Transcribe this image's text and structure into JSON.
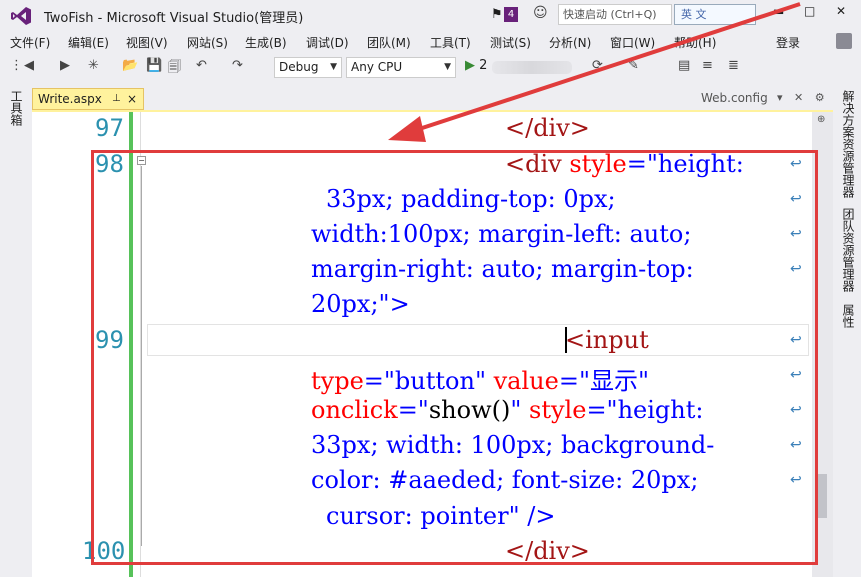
{
  "window": {
    "title": "TwoFish - Microsoft Visual Studio(管理员)",
    "notification_count": "4",
    "quick_launch_placeholder": "快速启动 (Ctrl+Q)",
    "ime_label": "英 文"
  },
  "menu": {
    "items": [
      "文件(F)",
      "编辑(E)",
      "视图(V)",
      "网站(S)",
      "生成(B)",
      "调试(D)",
      "团队(M)",
      "工具(T)",
      "测试(S)",
      "分析(N)",
      "窗口(W)",
      "帮助(H)"
    ],
    "login": "登录"
  },
  "toolbar": {
    "configuration": "Debug",
    "platform": "Any CPU",
    "start_label": "▶",
    "start_prefix": "2"
  },
  "side_panels": {
    "left": "工具箱",
    "right": [
      "解决方案资源管理器",
      "团队资源管理器",
      "属性"
    ]
  },
  "tabs": {
    "active": "Write.aspx",
    "active_pin": "⊥",
    "active_close": "×",
    "other": "Web.config",
    "other_icons": "▾ ✕ ⚙"
  },
  "code": {
    "line_numbers": [
      "97",
      "98",
      "99",
      "100"
    ],
    "line97": "</div>",
    "line98_a_tag": "<div",
    "line98_a_attr": "style",
    "line98_a_val": "=\"height:",
    "line98_b": "33px; padding-top: 0px;",
    "line98_c": "width:100px; margin-left: auto;",
    "line98_d": "margin-right: auto; margin-top:",
    "line98_e": "20px;\">",
    "line99_a": "<input",
    "line99_b_attr1": "type",
    "line99_b_val1": "=\"button\"",
    "line99_b_attr2": "value",
    "line99_b_val2": "=\"显示\"",
    "line99_c_attr": "onclick",
    "line99_c_eq": "=\"",
    "line99_c_fn": "show()",
    "line99_c_close": "\"",
    "line99_c_attr2": "style",
    "line99_c_val2": "=\"height:",
    "line99_d": "33px; width: 100px; background-",
    "line99_e": "color: #aaeded; font-size: 20px;",
    "line99_f": "cursor: pointer\" />",
    "line100": "</div>",
    "wrap_glyph": "↩"
  },
  "colors": {
    "annotation_red": "#e03c3c",
    "active_tab": "#fff29d",
    "tag": "#a31515",
    "attribute": "#ff0000",
    "value": "#0000ff",
    "line_number": "#2b91af",
    "gutter_changed": "#57c25a"
  }
}
